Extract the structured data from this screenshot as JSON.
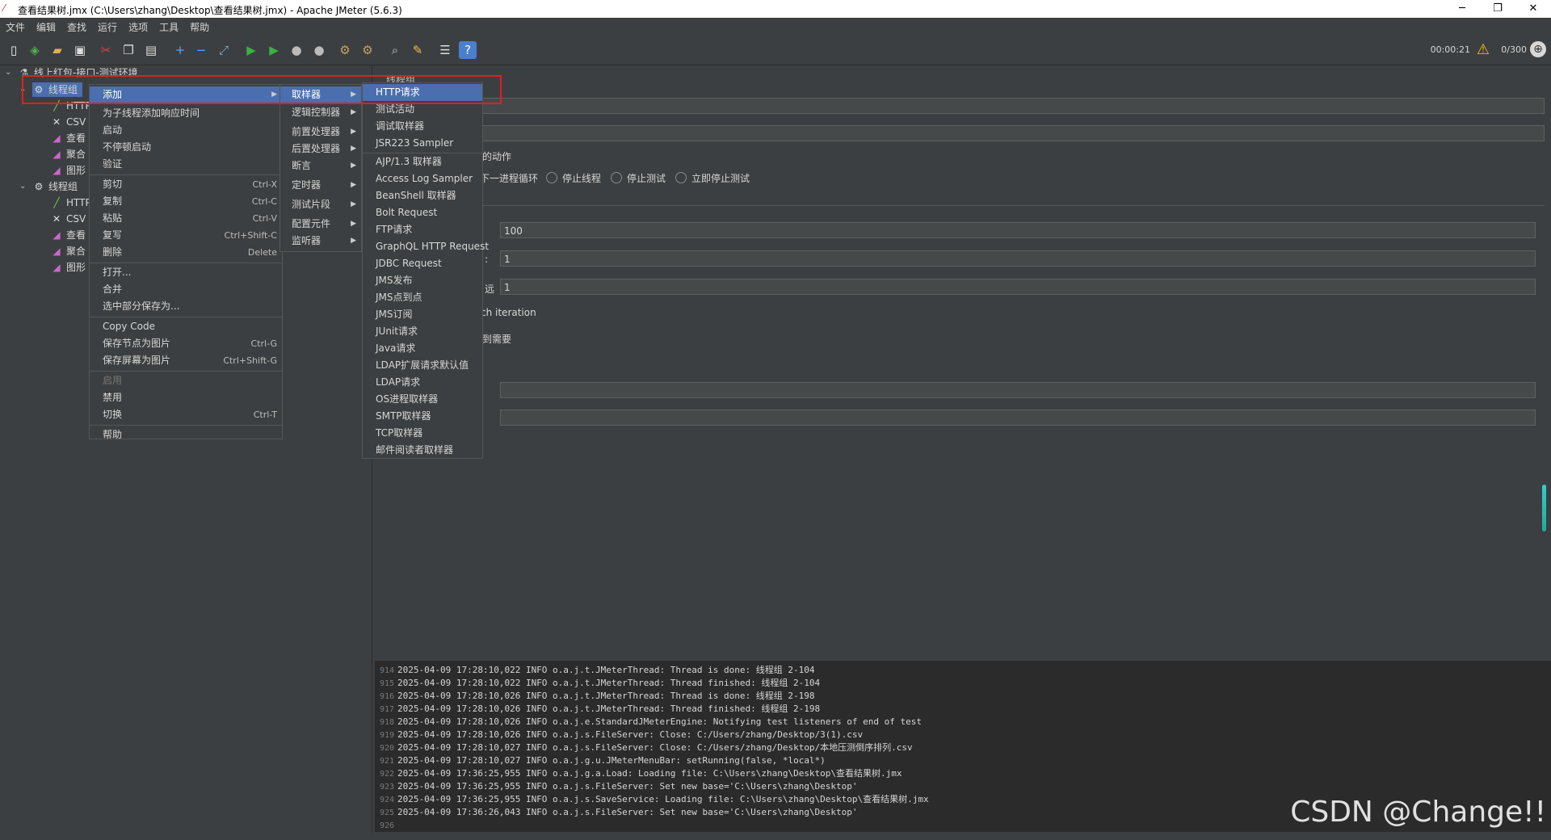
{
  "window": {
    "title": "查看结果树.jmx (C:\\Users\\zhang\\Desktop\\查看结果树.jmx) - Apache JMeter (5.6.3)",
    "minimize": "─",
    "restore": "❐",
    "close": "✕"
  },
  "menubar": [
    "文件",
    "编辑",
    "查找",
    "运行",
    "选项",
    "工具",
    "帮助"
  ],
  "status": {
    "timer": "00:00:21",
    "threads": "0/300"
  },
  "tree": {
    "root": "线上红包-接口-测试环境",
    "group1": "线程组",
    "group1_children": [
      "HTTP",
      "CSV",
      "查看",
      "聚合",
      "图形"
    ],
    "group2": "线程组",
    "group2_children": [
      "HTTP",
      "CSV",
      "查看",
      "聚合",
      "图形"
    ]
  },
  "panel": {
    "header": "线程组",
    "action_label": "的动作",
    "radios": [
      "下一进程循环",
      "停止线程",
      "停止测试",
      "立即停止测试"
    ],
    "thread_count": "100",
    "ramp_up": "1",
    "loop_count": "1",
    "label_colon": ":",
    "label_loop": "远",
    "iteration_text": "ch iteration",
    "delay_text": "到需要"
  },
  "context_menu": {
    "items": [
      {
        "label": "添加",
        "shortcut": "",
        "submenu": true
      },
      {
        "label": "为子线程添加响应时间",
        "shortcut": ""
      },
      {
        "label": "启动",
        "shortcut": ""
      },
      {
        "label": "不停顿启动",
        "shortcut": ""
      },
      {
        "label": "验证",
        "shortcut": ""
      },
      {
        "label": "剪切",
        "shortcut": "Ctrl-X"
      },
      {
        "label": "复制",
        "shortcut": "Ctrl-C"
      },
      {
        "label": "粘贴",
        "shortcut": "Ctrl-V"
      },
      {
        "label": "复写",
        "shortcut": "Ctrl+Shift-C"
      },
      {
        "label": "删除",
        "shortcut": "Delete"
      },
      {
        "label": "打开...",
        "shortcut": ""
      },
      {
        "label": "合并",
        "shortcut": ""
      },
      {
        "label": "选中部分保存为...",
        "shortcut": ""
      },
      {
        "label": "Copy Code",
        "shortcut": ""
      },
      {
        "label": "保存节点为图片",
        "shortcut": "Ctrl-G"
      },
      {
        "label": "保存屏幕为图片",
        "shortcut": "Ctrl+Shift-G"
      },
      {
        "label": "启用",
        "shortcut": ""
      },
      {
        "label": "禁用",
        "shortcut": ""
      },
      {
        "label": "切换",
        "shortcut": "Ctrl-T"
      },
      {
        "label": "帮助",
        "shortcut": ""
      }
    ]
  },
  "add_submenu": [
    "取样器",
    "逻辑控制器",
    "前置处理器",
    "后置处理器",
    "断言",
    "定时器",
    "测试片段",
    "配置元件",
    "监听器"
  ],
  "sampler_submenu": [
    "HTTP请求",
    "测试活动",
    "调试取样器",
    "JSR223 Sampler",
    "AJP/1.3 取样器",
    "Access Log Sampler",
    "BeanShell 取样器",
    "Bolt Request",
    "FTP请求",
    "GraphQL HTTP Request",
    "JDBC Request",
    "JMS发布",
    "JMS点到点",
    "JMS订阅",
    "JUnit请求",
    "Java请求",
    "LDAP扩展请求默认值",
    "LDAP请求",
    "OS进程取样器",
    "SMTP取样器",
    "TCP取样器",
    "邮件阅读者取样器"
  ],
  "log": {
    "lines": [
      {
        "n": "914",
        "t": "2025-04-09 17:28:10,022 INFO o.a.j.t.JMeterThread: Thread is done: 线程组 2-104"
      },
      {
        "n": "915",
        "t": "2025-04-09 17:28:10,022 INFO o.a.j.t.JMeterThread: Thread finished: 线程组 2-104"
      },
      {
        "n": "916",
        "t": "2025-04-09 17:28:10,026 INFO o.a.j.t.JMeterThread: Thread is done: 线程组 2-198"
      },
      {
        "n": "917",
        "t": "2025-04-09 17:28:10,026 INFO o.a.j.t.JMeterThread: Thread finished: 线程组 2-198"
      },
      {
        "n": "918",
        "t": "2025-04-09 17:28:10,026 INFO o.a.j.e.StandardJMeterEngine: Notifying test listeners of end of test"
      },
      {
        "n": "919",
        "t": "2025-04-09 17:28:10,026 INFO o.a.j.s.FileServer: Close: C:/Users/zhang/Desktop/3(1).csv"
      },
      {
        "n": "920",
        "t": "2025-04-09 17:28:10,027 INFO o.a.j.s.FileServer: Close: C:/Users/zhang/Desktop/本地压测倒序排列.csv"
      },
      {
        "n": "921",
        "t": "2025-04-09 17:28:10,027 INFO o.a.j.g.u.JMeterMenuBar: setRunning(false, *local*)"
      },
      {
        "n": "922",
        "t": "2025-04-09 17:36:25,955 INFO o.a.j.g.a.Load: Loading file: C:\\Users\\zhang\\Desktop\\查看结果树.jmx"
      },
      {
        "n": "923",
        "t": "2025-04-09 17:36:25,955 INFO o.a.j.s.FileServer: Set new base='C:\\Users\\zhang\\Desktop'"
      },
      {
        "n": "924",
        "t": "2025-04-09 17:36:25,955 INFO o.a.j.s.SaveService: Loading file: C:\\Users\\zhang\\Desktop\\查看结果树.jmx"
      },
      {
        "n": "925",
        "t": "2025-04-09 17:36:26,043 INFO o.a.j.s.FileServer: Set new base='C:\\Users\\zhang\\Desktop'"
      },
      {
        "n": "926",
        "t": ""
      }
    ]
  },
  "watermark": "CSDN @Change!!"
}
